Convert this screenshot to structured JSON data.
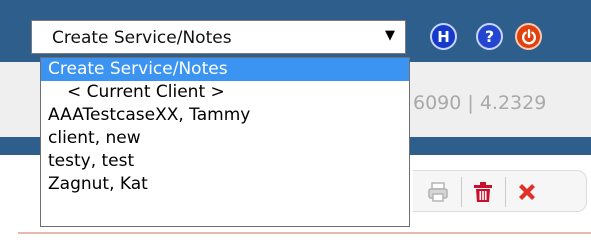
{
  "header": {
    "select_value": "Create Service/Notes",
    "dropdown_arrow": "▼",
    "icons": [
      {
        "name": "help-h-icon",
        "glyph": "H",
        "color": "#1539c9"
      },
      {
        "name": "help-question-icon",
        "glyph": "?",
        "color": "#2346d0"
      },
      {
        "name": "power-icon",
        "glyph": "power",
        "color": "#e1410b"
      }
    ]
  },
  "info": {
    "numbers": "6090 | 4.2329"
  },
  "dropdown": {
    "options": [
      {
        "label": "Create Service/Notes",
        "selected": true
      },
      {
        "label": "< Current Client >",
        "selected": false
      },
      {
        "label": "AAATestcaseXX, Tammy",
        "selected": false
      },
      {
        "label": "client, new",
        "selected": false
      },
      {
        "label": "testy, test",
        "selected": false
      },
      {
        "label": "Zagnut, Kat",
        "selected": false
      }
    ]
  },
  "toolbar": {
    "icons": [
      "print-icon",
      "trash-icon",
      "close-icon"
    ]
  },
  "colors": {
    "header_bg": "#2e5e8c",
    "selected_option": "#3c94f2",
    "delete_red": "#c8102e",
    "close_red": "#e0302a"
  }
}
